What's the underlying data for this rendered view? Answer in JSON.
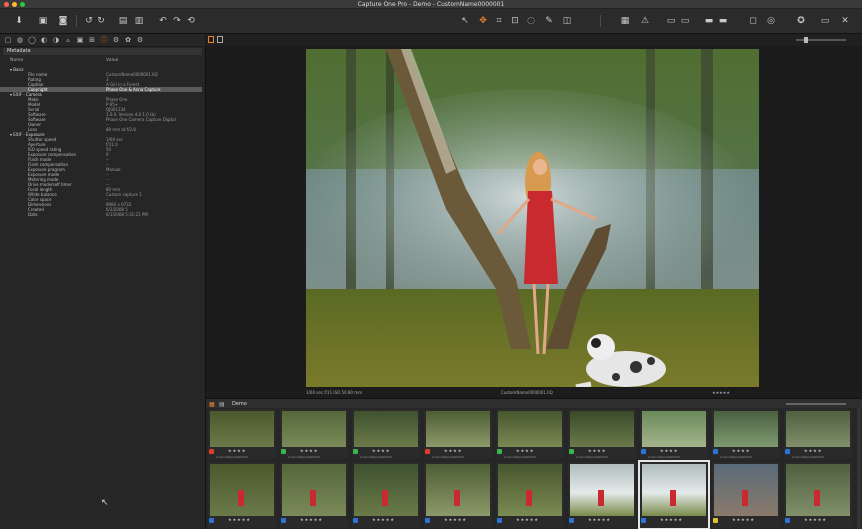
{
  "window": {
    "title": "Capture One Pro - Demo - CustomName0000001",
    "traffic_colors": [
      "#ff5f57",
      "#febc2e",
      "#28c840"
    ]
  },
  "toolbar": {
    "icons": [
      "import-icon",
      "library-icon",
      "camera-icon",
      "rotate-left-icon",
      "rotate-right-icon",
      "folder-icon",
      "trash-icon",
      "undo-icon",
      "redo-icon",
      "reset-icon",
      "cursor-tool-icon",
      "crop-tool-icon",
      "straighten-icon",
      "keystone-icon",
      "spot-icon",
      "brush-icon",
      "gradient-icon",
      "grid-icon",
      "exposure-warning-icon",
      "compare-icon",
      "viewer-icon",
      "slideshow-icon",
      "proof-icon",
      "proof2-icon",
      "settings-icon",
      "help-icon",
      "close-viewer-icon",
      "shrink-icon"
    ]
  },
  "tool_tabs": {
    "icons": [
      "library-tab-icon",
      "capture-tab-icon",
      "lens-tab-icon",
      "color-tab-icon",
      "exposure-tab-icon",
      "details-tab-icon",
      "local-tab-icon",
      "composition-tab-icon",
      "metadata-tab-icon",
      "output-tab-icon",
      "adjust-tab-icon",
      "batch-tab-icon"
    ],
    "active_index": 8
  },
  "sidebar": {
    "panel_title": "Metadata",
    "col_name": "Name",
    "col_value": "Value",
    "rows": [
      {
        "section": true,
        "k": "Basic",
        "v": ""
      },
      {
        "k": "File name",
        "v": "CustomName0000001.IIQ"
      },
      {
        "k": "Rating",
        "v": "3"
      },
      {
        "k": "Caption",
        "v": "A Girl in a Forest"
      },
      {
        "k": "Copyright",
        "v": "Phase One & Anna Capture",
        "hl": true
      },
      {
        "section": true,
        "k": "EXIF - Camera",
        "v": ""
      },
      {
        "k": "Make",
        "v": "Phase One"
      },
      {
        "k": "Model",
        "v": "P 65+"
      },
      {
        "k": "Serial",
        "v": "QJ001234"
      },
      {
        "k": "Software",
        "v": "1.0.0, Version 4.0.1.0 (b)"
      },
      {
        "k": "Software",
        "v": "Phase One Camera Capture Digital"
      },
      {
        "k": "Owner",
        "v": "--"
      },
      {
        "k": "Lens",
        "v": "80 mm at f/2.8"
      },
      {
        "section": true,
        "k": "EXIF - Exposure",
        "v": ""
      },
      {
        "k": "Shutter speed",
        "v": "1/60 sec"
      },
      {
        "k": "Aperture",
        "v": "f/11.0"
      },
      {
        "k": "ISO speed rating",
        "v": "50"
      },
      {
        "k": "Exposure compensation",
        "v": "0"
      },
      {
        "k": "Flash mode",
        "v": "--"
      },
      {
        "k": "Flash compensation",
        "v": "--"
      },
      {
        "k": "Exposure program",
        "v": "Manual"
      },
      {
        "k": "Exposure mode",
        "v": "--"
      },
      {
        "k": "Metering mode",
        "v": "--"
      },
      {
        "k": "Drive mode/self timer",
        "v": "--"
      },
      {
        "k": "Focal length",
        "v": "80 mm"
      },
      {
        "k": "White balance",
        "v": "Custom capture 1"
      },
      {
        "k": "Color space",
        "v": "--"
      },
      {
        "k": "Dimensions",
        "v": "8984 x 6732"
      },
      {
        "k": "Created",
        "v": "6/2/2008 5"
      },
      {
        "k": "Date",
        "v": "6/1/2008 5:31:21 PM"
      }
    ]
  },
  "viewer": {
    "caption_left": "1/60 sec  f/11  ISO 50  80 mm",
    "caption_center": "CustomName0000001.IIQ",
    "caption_stars": "★★★★★"
  },
  "browser": {
    "tab_label": "Demo",
    "thumbs_row1": [
      {
        "tag": "#e03b2f",
        "stars": "★★★★",
        "file": "CustomName000000"
      },
      {
        "tag": "#3cb44b",
        "stars": "★★★★",
        "file": "CustomName000000"
      },
      {
        "tag": "#3cb44b",
        "stars": "★★★★",
        "file": "CustomName000000"
      },
      {
        "tag": "#e03b2f",
        "stars": "★★★★",
        "file": "CustomName000000"
      },
      {
        "tag": "#3cb44b",
        "stars": "★★★★",
        "file": "CustomName000000"
      },
      {
        "tag": "#3cb44b",
        "stars": "★★★★",
        "file": "CustomName000000"
      },
      {
        "tag": "#2d72d9",
        "stars": "★★★★",
        "file": "CustomName000000"
      },
      {
        "tag": "#2d72d9",
        "stars": "★★★★",
        "file": "CustomName000000"
      },
      {
        "tag": "#2d72d9",
        "stars": "★★★★",
        "file": "CustomName000000"
      }
    ],
    "thumbs_row2": [
      {
        "tag": "#2d72d9",
        "stars": "★★★★★"
      },
      {
        "tag": "#2d72d9",
        "stars": "★★★★★"
      },
      {
        "tag": "#2d72d9",
        "stars": "★★★★★"
      },
      {
        "tag": "#2d72d9",
        "stars": "★★★★★"
      },
      {
        "tag": "#2d72d9",
        "stars": "★★★★★"
      },
      {
        "tag": "#2d72d9",
        "stars": "★★★★★"
      },
      {
        "tag": "#2d72d9",
        "stars": "★★★★★"
      },
      {
        "tag": "#e0c22d",
        "stars": "★★★★★"
      },
      {
        "tag": "#2d72d9",
        "stars": "★★★★★"
      }
    ]
  },
  "colors": {
    "accent": "#e8842c",
    "panel": "#262626",
    "highlight_row": "#5a5a5a"
  }
}
